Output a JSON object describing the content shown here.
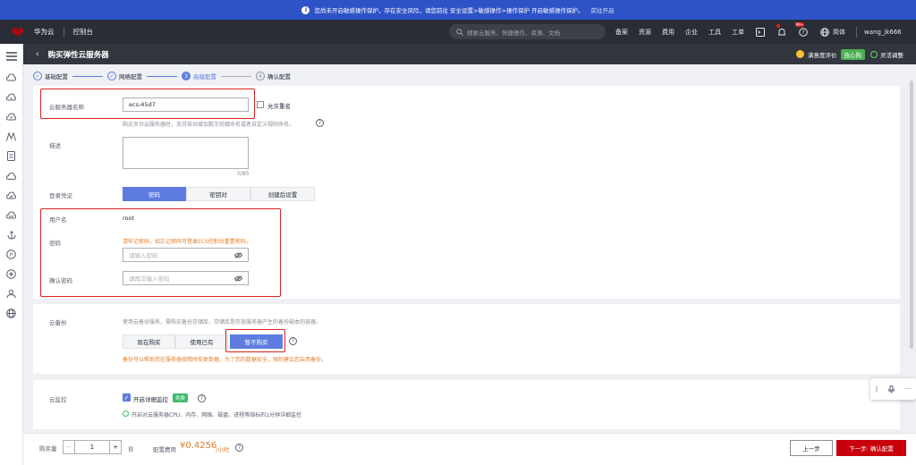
{
  "notice": {
    "text": "您尚未开启敏感操作保护，存在安全风险，请您前往 安全设置>敏感操作>操作保护 开启敏感操作保护。",
    "link": "前往开启"
  },
  "header": {
    "brand": "华为云",
    "console": "控制台",
    "search_placeholder": "搜索云服务、快捷操作、资源、文档",
    "nav": [
      "备案",
      "资源",
      "费用",
      "企业",
      "工具",
      "工单"
    ],
    "lang": "简体",
    "user": "wang_jk666",
    "notification_badge": "99+"
  },
  "title": {
    "page_title": "购买弹性云服务器",
    "rating": "满意度评价",
    "rating_badge": "放心购",
    "flex_adjust": "灵活调整"
  },
  "steps": [
    {
      "label": "基础配置",
      "state": "done"
    },
    {
      "label": "网络配置",
      "state": "done"
    },
    {
      "num": "3",
      "label": "高级配置",
      "state": "active"
    },
    {
      "num": "4",
      "label": "确认配置",
      "state": "todo"
    }
  ],
  "form": {
    "server_name_label": "云服务器名称",
    "server_name_value": "ecs-45d7",
    "allow_duplicate": "允许重名",
    "server_name_hint": "购买多台云服务器时，支持自动增加数字后缀命名或者自定义规则命名。",
    "desc_label": "描述",
    "desc_count": "0/85",
    "login_label": "登录凭证",
    "login_options": [
      "密码",
      "密钥对",
      "创建后设置"
    ],
    "username_label": "用户名",
    "username_value": "root",
    "password_label": "密码",
    "password_warning": "请牢记密码，如忘记密码可登录ECS控制台重置密码。",
    "password_placeholder": "请输入密码",
    "confirm_label": "确认密码",
    "confirm_placeholder": "请再次输入密码"
  },
  "backup": {
    "label": "云备份",
    "hint": "使用云备份服务，需购买备份存储库，存储库是存放服务器产生的备份副本的容器。",
    "options": [
      "现在购买",
      "使用已有",
      "暂不购买"
    ],
    "warning": "备份可以帮助您在服务器故障时恢复数据，为了您的数据安全，强烈建议您启用备份。"
  },
  "monitor": {
    "label": "云监控",
    "checkbox_label": "开启详细监控",
    "free_badge": "免费",
    "desc": "开启对云服务器CPU、内存、网络、磁盘、进程等指标的1分钟详细监控"
  },
  "bottom": {
    "qty_label": "购买量",
    "qty_value": "1",
    "unit": "台",
    "fee_label": "配置费用",
    "price": "¥0.4256",
    "price_unit": "/小时",
    "prev": "上一步",
    "next": "下一步: 确认配置"
  },
  "colors": {
    "accent": "#5e7ce0",
    "primary_red": "#c7000b",
    "warn": "#e37d29",
    "highlight": "#e02020"
  }
}
